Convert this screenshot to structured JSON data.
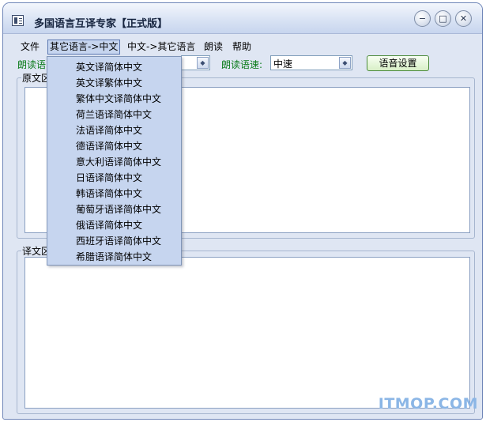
{
  "window": {
    "title": "多国语言互译专家【正式版】",
    "buttons": {
      "minimize": "−",
      "maximize": "□",
      "close": "✕"
    }
  },
  "menubar": {
    "items": [
      "文件",
      "其它语言->中文",
      "中文->其它语言",
      "朗读",
      "帮助"
    ],
    "active_index": 1
  },
  "options": {
    "read_language_label": "朗读语",
    "read_speed_label": "朗读语速:",
    "read_speed_value": "中速",
    "voice_settings_button": "语音设置"
  },
  "source_group": {
    "label": "原文区"
  },
  "target_group": {
    "label": "译文区"
  },
  "dropdown": {
    "items": [
      "英文译简体中文",
      "英文译繁体中文",
      "繁体中文译简体中文",
      "荷兰语译简体中文",
      "法语译简体中文",
      "德语译简体中文",
      "意大利语译简体中文",
      "日语译简体中文",
      "韩语译简体中文",
      "葡萄牙语译简体中文",
      "俄语译简体中文",
      "西班牙语译简体中文",
      "希腊语译简体中文"
    ]
  },
  "watermark": "ITMOP.COM",
  "colors": {
    "accent_green": "#0a7b1a",
    "menu_highlight": "#c6d5ef",
    "window_bg": "#dfe6f3"
  }
}
